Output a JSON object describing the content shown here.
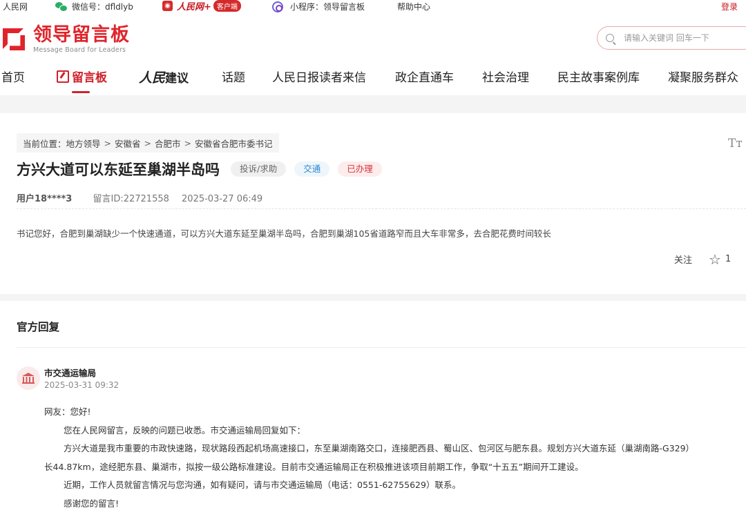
{
  "topbar": {
    "site": "人民网",
    "wechat": "微信号：dfldlyb",
    "app_logo_text": "人民网+",
    "app_tag": "客户端",
    "miniprogram": "小程序：领导留言板",
    "help": "帮助中心",
    "login": "登录"
  },
  "header": {
    "logo_cn": "领导留言板",
    "logo_en": "Message Board for Leaders",
    "search_placeholder": "请输入关键词 回车一下"
  },
  "nav": {
    "items": [
      "首页",
      "留言板",
      "人民建议",
      "话题",
      "人民日报读者来信",
      "政企直通车",
      "社会治理",
      "民主故事案例库",
      "凝聚服务群众"
    ],
    "jianyi_prefix": "人民",
    "jianyi_suffix": "建议"
  },
  "breadcrumb": {
    "label": "当前位置：",
    "items": [
      "地方领导",
      "安徽省",
      "合肥市",
      "安徽省合肥市委书记"
    ],
    "sep": ">"
  },
  "font_toggle": "Tт",
  "message": {
    "title": "方兴大道可以东延至巢湖半岛吗",
    "category": "投诉/求助",
    "topic": "交通",
    "status": "已办理",
    "user": "用户18****3",
    "id": "留言ID:22721558",
    "time": "2025-03-27 06:49",
    "content": "书记您好，合肥到巢湖缺少一个快速通道，可以方兴大道东延至巢湖半岛吗，合肥到巢湖105省道路窄而且大车非常多，去合肥花费时间较长",
    "follow": "关注",
    "star_count": "1"
  },
  "reply": {
    "section_title": "官方回复",
    "dept": "市交通运输局",
    "date": "2025-03-31 09:32",
    "lines": [
      "网友：您好!",
      "您在人民网留言，反映的问题已收悉。市交通运输局回复如下：",
      "方兴大道是我市重要的市政快速路，现状路段西起机场高速接口，东至巢湖南路交口，连接肥西县、蜀山区、包河区与肥东县。规划方兴大道东延（巢湖南路-G329）",
      "长44.87km，途经肥东县、巢湖市，拟按一级公路标准建设。目前市交通运输局正在积极推进该项目前期工作，争取“十五五”期间开工建设。",
      "近期，工作人员就留言情况与您沟通，如有疑问，请与市交通运输局（电话：0551-62755629）联系。",
      "感谢您的留言!"
    ]
  }
}
